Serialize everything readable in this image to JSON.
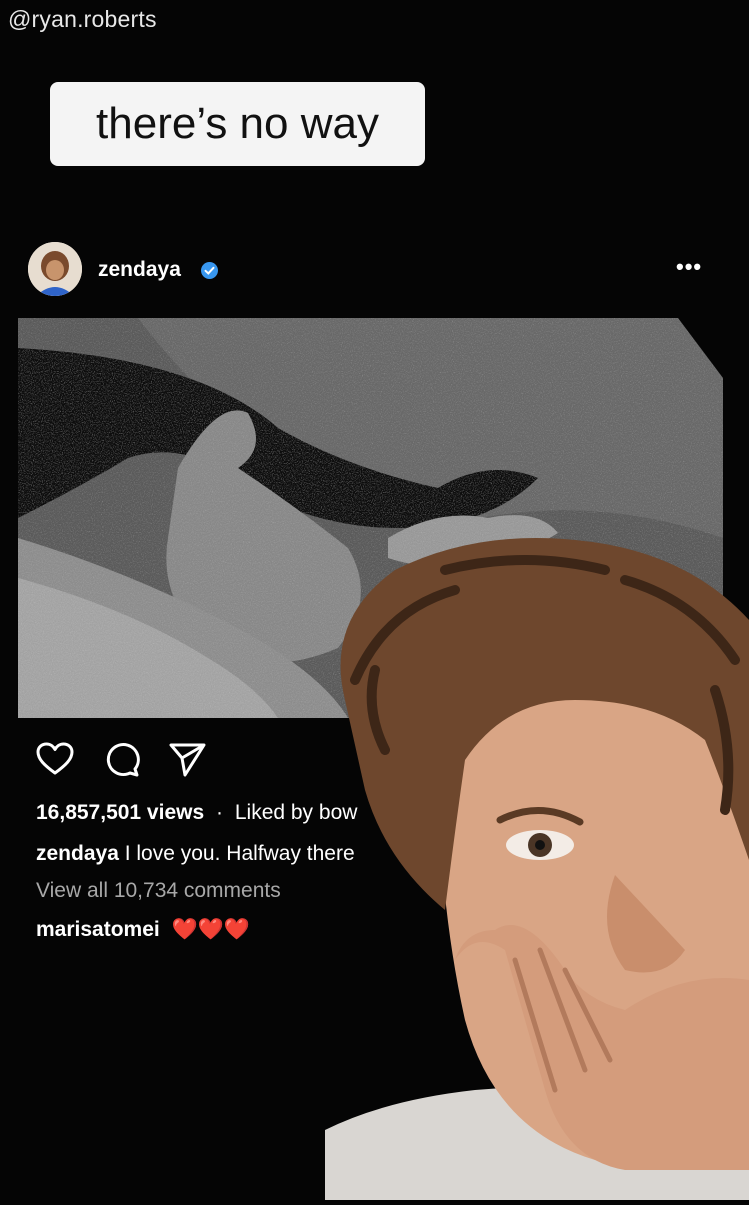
{
  "watermark": "@ryan.roberts",
  "caption": "there’s no way",
  "post": {
    "username": "zendaya",
    "more": "•••",
    "views": "16,857,501 views",
    "dot": "·",
    "liked_by": "Liked by bow",
    "caption_user": "zendaya",
    "caption_text": "I love you. Halfway there",
    "view_comments": "View all 10,734 comments",
    "comment_user": "marisatomei",
    "comment_text": "❤️❤️❤️"
  },
  "icons": [
    "heart-icon",
    "comment-icon",
    "share-icon",
    "verified-icon",
    "more-icon"
  ],
  "colors": {
    "background": "#050505",
    "verified": "#3897f0",
    "heart": "#e0245e"
  }
}
